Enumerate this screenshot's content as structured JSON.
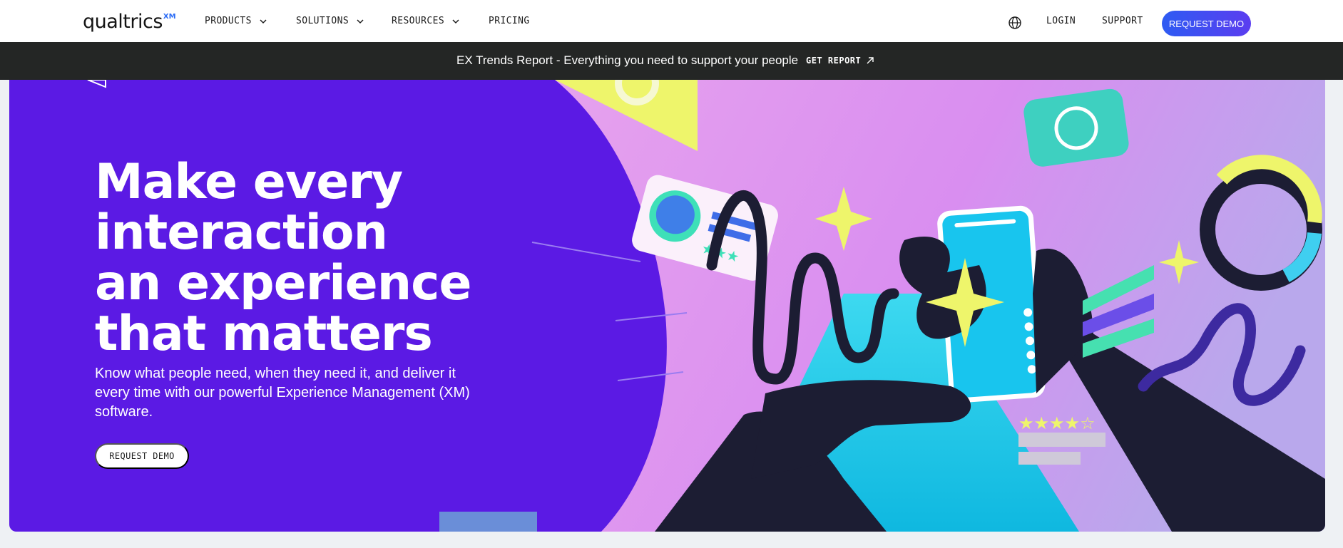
{
  "brand": {
    "name": "qualtrics",
    "suffix": "XM"
  },
  "nav": {
    "items": [
      {
        "label": "PRODUCTS",
        "dropdown": true
      },
      {
        "label": "SOLUTIONS",
        "dropdown": true
      },
      {
        "label": "RESOURCES",
        "dropdown": true
      },
      {
        "label": "PRICING",
        "dropdown": false
      }
    ],
    "globe_icon": "globe-icon",
    "login": "LOGIN",
    "support": "SUPPORT",
    "request_demo": "REQUEST DEMO"
  },
  "banner": {
    "text": "EX Trends Report - Everything you need to support your people",
    "link_label": "GET REPORT",
    "link_icon": "arrow-up-right-icon"
  },
  "hero": {
    "headline_lines": [
      "Make every",
      "interaction",
      "an experience",
      "that matters"
    ],
    "subtext": "Know what people need, when they need it, and deliver it every time with our powerful Experience Management (XM) software.",
    "cta": "REQUEST DEMO"
  },
  "colors": {
    "hero_bg": "#5b1ae4",
    "art_pink": "#d98ef0",
    "art_cyan": "#17c7e6",
    "art_yellow": "#eef56b",
    "art_dark": "#1c1d33",
    "banner_bg": "#242625",
    "cta_gradient_start": "#2e5bf2",
    "cta_gradient_end": "#5b3df0"
  }
}
